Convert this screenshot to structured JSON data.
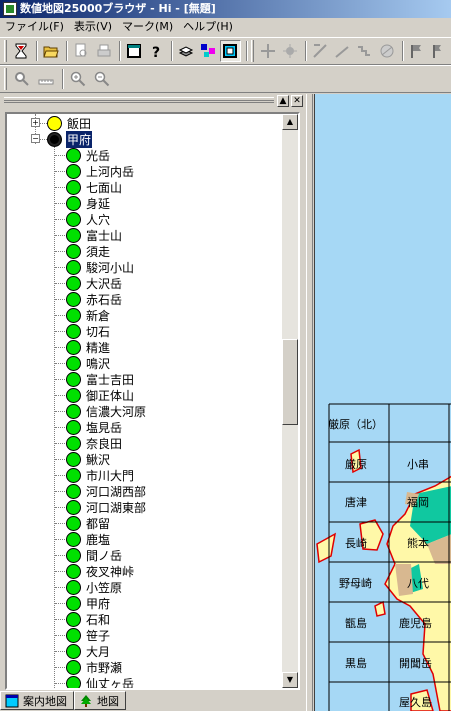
{
  "window": {
    "title": "数値地図25000ブラウザ - Hi - [無題]"
  },
  "menu": {
    "items": [
      "ファイル(F)",
      "表示(V)",
      "マーク(M)",
      "ヘルプ(H)"
    ]
  },
  "tree": {
    "parents": [
      {
        "label": "飯田",
        "expanded": false,
        "color": "#ffff00"
      },
      {
        "label": "甲府",
        "expanded": true,
        "selected": true,
        "color": "#000000"
      }
    ],
    "children": [
      "光岳",
      "上河内岳",
      "七面山",
      "身延",
      "人穴",
      "富士山",
      "須走",
      "駿河小山",
      "大沢岳",
      "赤石岳",
      "新倉",
      "切石",
      "精進",
      "鳴沢",
      "富士吉田",
      "御正体山",
      "信濃大河原",
      "塩見岳",
      "奈良田",
      "鰍沢",
      "市川大門",
      "河口湖西部",
      "河口湖東部",
      "都留",
      "鹿塩",
      "間ノ岳",
      "夜叉神峠",
      "小笠原",
      "甲府",
      "石和",
      "笹子",
      "大月",
      "市野瀬",
      "仙丈ヶ岳"
    ],
    "child_color": "#00e000"
  },
  "tabs": [
    {
      "label": "案内地図",
      "active": true
    },
    {
      "label": "地図",
      "active": false
    }
  ],
  "panel_buttons": {
    "restore": "▲",
    "close": "✕"
  },
  "scroll": {
    "up": "▲",
    "down": "▼"
  },
  "map": {
    "labels": [
      "厳原（北）",
      "厳原",
      "小串",
      "唐津",
      "福岡",
      "長崎",
      "熊本",
      "野母崎",
      "八代",
      "甑島",
      "鹿児島",
      "黒島",
      "開聞岳",
      "屋久島"
    ],
    "colors": {
      "sea": "#a6d8f5",
      "land": "#fff8a8",
      "teal": "#10c8a0",
      "tan": "#d8b890",
      "boundary": "#e00000"
    }
  }
}
